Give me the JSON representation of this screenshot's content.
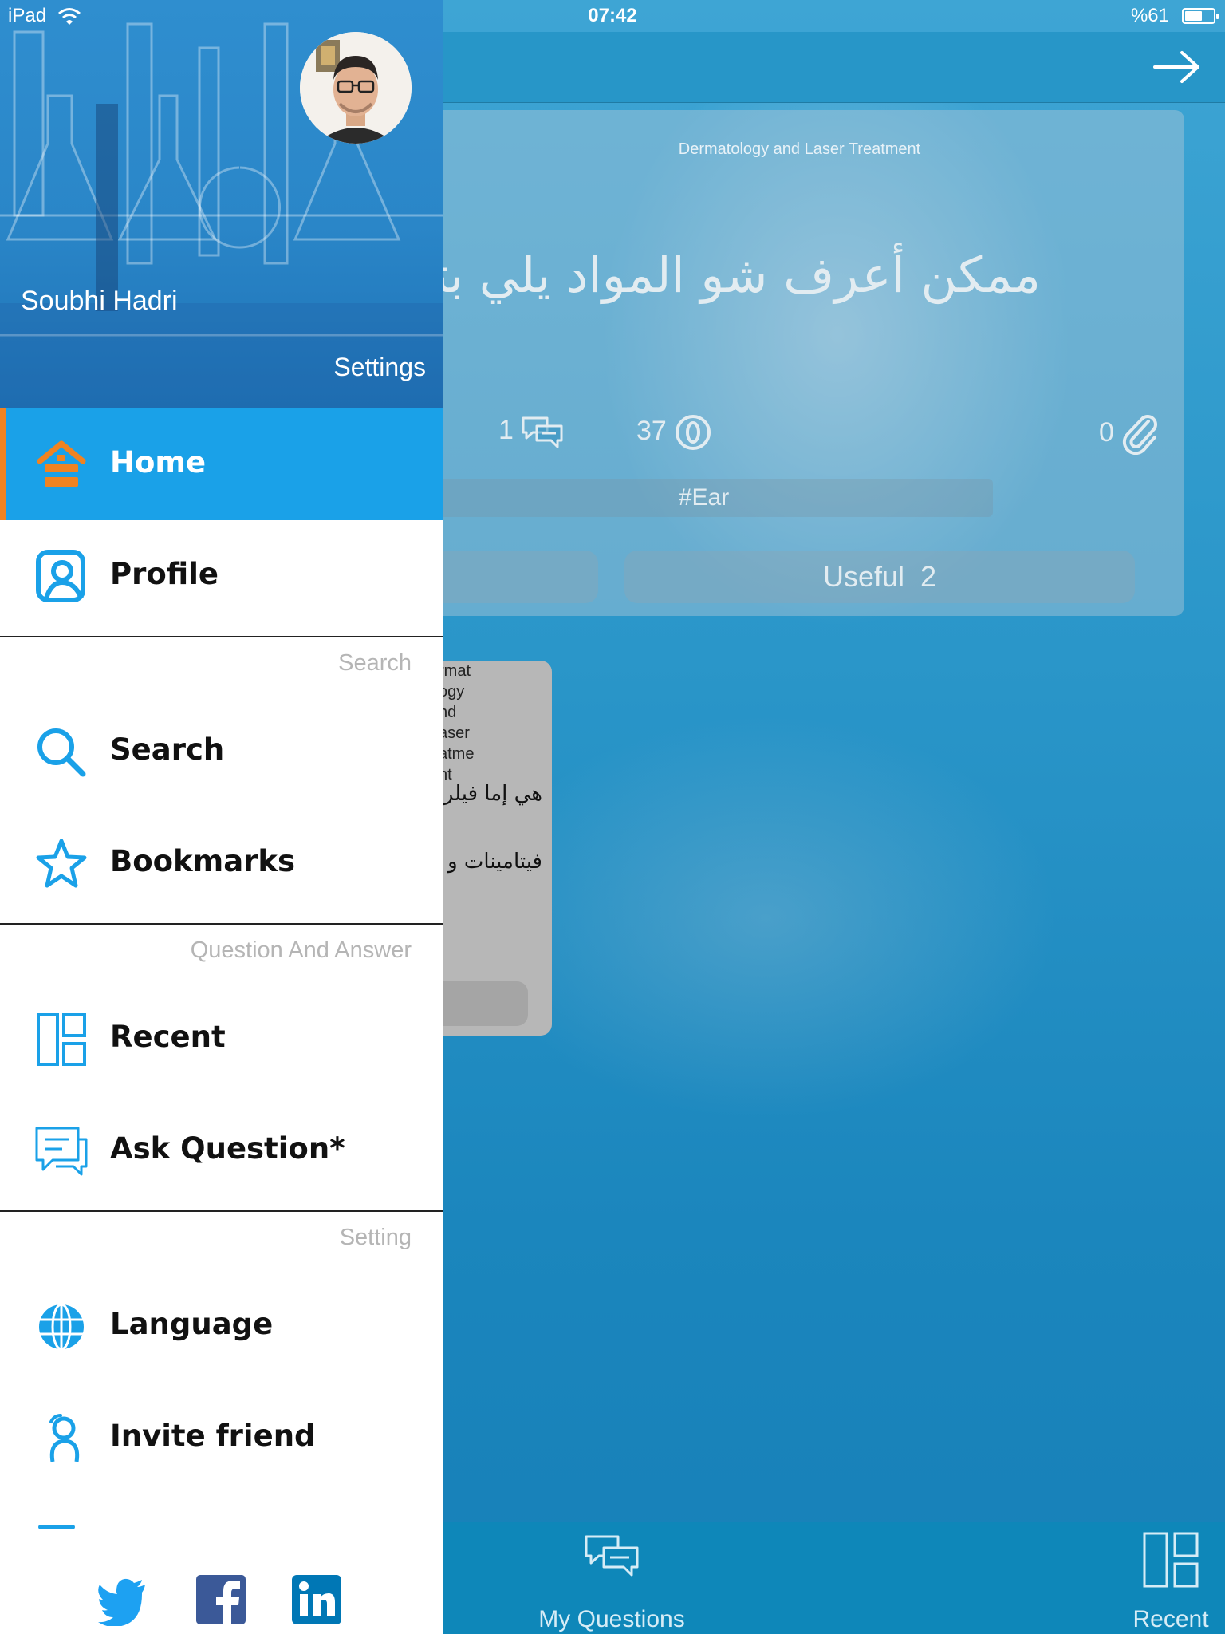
{
  "status_bar": {
    "carrier": "iPad",
    "time": "07:42",
    "battery": "%61",
    "battery_level": 0.61
  },
  "card": {
    "category": "Dermatology and Laser Treatment",
    "title": "ممكن أعرف شو المواد يلي بتح",
    "answers_count": "1",
    "views_count": "37",
    "attachments_count": "0",
    "tag": "#Ear",
    "useful_label": "Useful",
    "useful_count": "2"
  },
  "answer": {
    "category_lines": [
      "rmat",
      "ogy",
      "nd",
      "aser",
      "atme",
      "nt"
    ],
    "line1": "هي إما فيلر",
    "line2": "فيتامينات و"
  },
  "tab_bar": {
    "my_questions": "My Questions",
    "recent": "Recent"
  },
  "drawer": {
    "user_name": "Soubhi Hadri",
    "settings": "Settings",
    "items": {
      "home": "Home",
      "profile": "Profile",
      "search": "Search",
      "bookmarks": "Bookmarks",
      "recent": "Recent",
      "ask_question": "Ask Question*",
      "language": "Language",
      "invite_friend": "Invite friend"
    },
    "sections": {
      "search": "Search",
      "qa": "Question And Answer",
      "setting": "Setting"
    }
  },
  "colors": {
    "accent_blue": "#1aa1e8",
    "active_indicator": "#f08321",
    "icon_blue": "#1aa1e8",
    "twitter": "#1da1f2",
    "facebook": "#3b5998",
    "linkedin": "#0077b5"
  },
  "icons": [
    "wifi-icon",
    "battery-icon",
    "arrow-right-icon",
    "chat-icon",
    "eye-icon",
    "paperclip-icon",
    "home-icon",
    "profile-icon",
    "search-icon",
    "star-icon",
    "grid-icon",
    "question-icon",
    "globe-icon",
    "invite-icon",
    "twitter-icon",
    "facebook-icon",
    "linkedin-icon"
  ]
}
